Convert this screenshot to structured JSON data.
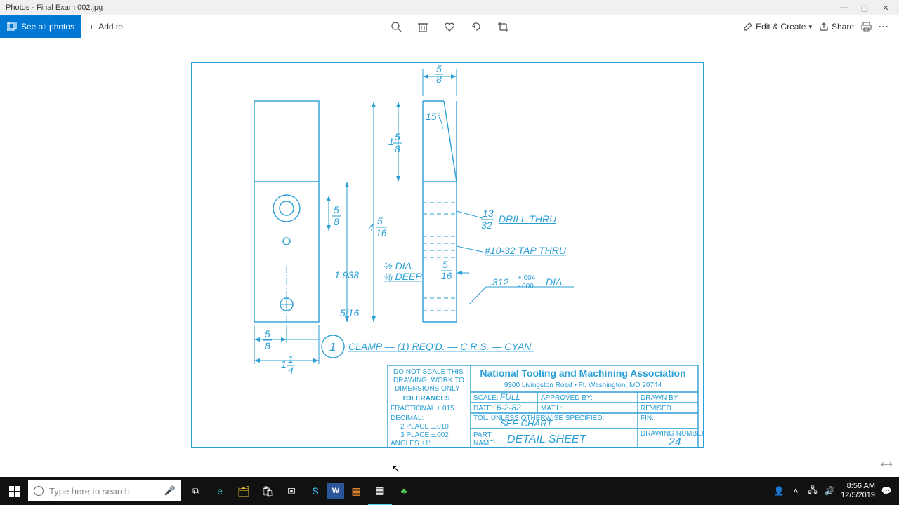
{
  "window": {
    "title": "Photos - Final Exam 002.jpg"
  },
  "toolbar": {
    "see_all": "See all photos",
    "add_to": "Add to",
    "edit": "Edit & Create",
    "share": "Share"
  },
  "drawing": {
    "dims": {
      "d_5_8_top": "5",
      "d_5_8_top_den": "8",
      "angle_15": "15°",
      "d_1_5_8_num": "5",
      "d_1_5_8_den": "8",
      "d_1_5_8_whole": "1",
      "d_5_8_mid_num": "5",
      "d_5_8_mid_den": "8",
      "d_4_5_16_whole": "4",
      "d_4_5_16_num": "5",
      "d_4_5_16_den": "16",
      "d_1938": "1.938",
      "half_dia": "½ DIA.",
      "eighth_deep": "⅛ DEEP",
      "d_5_16r_num": "5",
      "d_5_16r_den": "16",
      "d_5_16_b": "5/16",
      "d_5_8_left_num": "5",
      "d_5_8_left_den": "8",
      "d_1_1_4_whole": "1",
      "d_1_1_4_num": "1",
      "d_1_1_4_den": "4",
      "d_13_32_num": "13",
      "d_13_32_den": "32",
      "drill_thru": "DRILL THRU",
      "tap": "#10-32 TAP THRU",
      "d_312": ".312",
      "tol_p": "+.004",
      "tol_m": "-.000",
      "dia": "DIA.",
      "callout": "CLAMP — (1) REQ'D. — C.R.S. — CYAN.",
      "ballnum": "1"
    },
    "block": {
      "no_scale1": "DO NOT SCALE THIS",
      "no_scale2": "DRAWING. WORK TO",
      "no_scale3": "DIMENSIONS ONLY",
      "tol_head": "TOLERANCES",
      "frac": "FRACTIONAL ±.015",
      "dec": "DECIMAL:",
      "dec2": "2 PLACE ±.010",
      "dec3": "3 PLACE ±.002",
      "ang": "ANGLES   ±1°",
      "org": "National Tooling and Machining Association",
      "addr": "9300 Livingston Road   •   Ft. Washington, MD 20744",
      "scale_l": "SCALE:",
      "scale_v": "FULL",
      "appr": "APPROVED BY:",
      "drawn": "DRAWN BY",
      "date_l": "DATE:",
      "date_v": "6-2-82",
      "matl": "MAT'L:",
      "rev": "REVISED",
      "tol_note": "TOL. UNLESS OTHERWISE SPECIFIED:",
      "fin": "FIN.:",
      "see_chart": "SEE CHART",
      "part_l": "PART",
      "name_l": "NAME:",
      "part_v": "DETAIL SHEET",
      "dwg_l": "DRAWING NUMBER",
      "dwg_v": "24"
    }
  },
  "taskbar": {
    "search_placeholder": "Type here to search"
  },
  "tray": {
    "time": "8:56 AM",
    "date": "12/5/2019"
  }
}
